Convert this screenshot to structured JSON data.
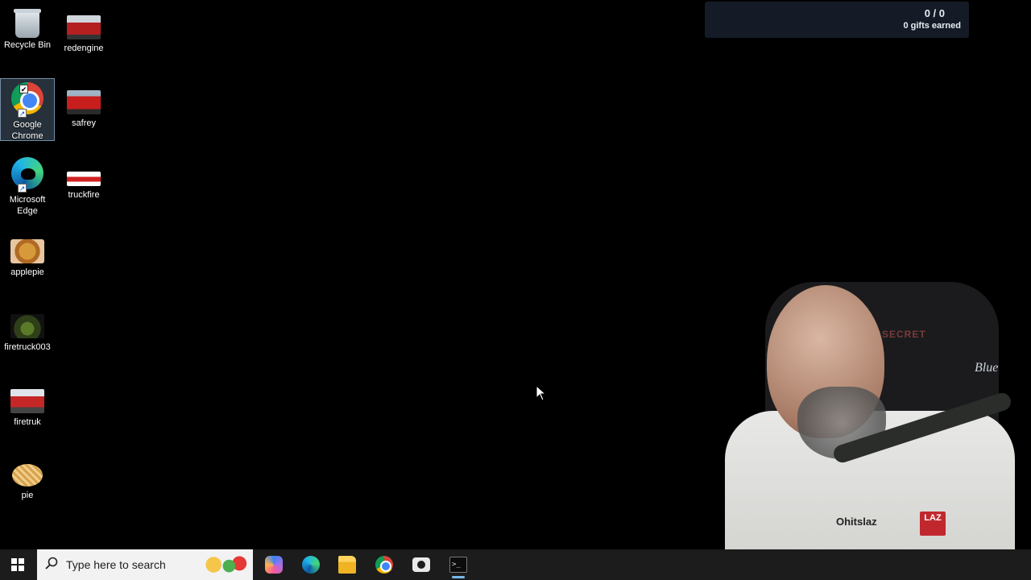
{
  "desktop_icons": {
    "col1": [
      {
        "label": "Recycle Bin",
        "icon": "recycle-bin-icon"
      },
      {
        "label": "Google\nChrome",
        "icon": "chrome-icon",
        "selected": true
      },
      {
        "label": "Microsoft\nEdge",
        "icon": "edge-icon"
      },
      {
        "label": "applepie",
        "icon": "image-thumbnail-icon"
      },
      {
        "label": "firetruck003",
        "icon": "image-thumbnail-icon"
      },
      {
        "label": "firetruk",
        "icon": "image-thumbnail-icon"
      },
      {
        "label": "pie",
        "icon": "image-thumbnail-icon"
      }
    ],
    "col2": [
      {
        "label": "redengine",
        "icon": "image-thumbnail-icon"
      },
      {
        "label": "safrey",
        "icon": "image-thumbnail-icon"
      },
      {
        "label": "truckfire",
        "icon": "image-thumbnail-icon"
      }
    ]
  },
  "gifts_widget": {
    "count": "0 / 0",
    "earned": "0 gifts earned"
  },
  "webcam": {
    "chair_text": "SECRET",
    "mic_brand": "Blue",
    "shirt_text": "Ohitslaz",
    "badge_text": "LAZ"
  },
  "taskbar": {
    "search_placeholder": "Type here to search",
    "apps": [
      {
        "icon": "copilot-icon"
      },
      {
        "icon": "edge-icon"
      },
      {
        "icon": "file-explorer-icon"
      },
      {
        "icon": "chrome-icon"
      },
      {
        "icon": "camera-icon"
      },
      {
        "icon": "terminal-icon",
        "active": true
      }
    ]
  },
  "colors": {
    "desktop_bg": "#000000",
    "taskbar_bg": "#1c1c1c",
    "widget_bg": "#141b26",
    "active_indicator": "#76b9ed"
  }
}
